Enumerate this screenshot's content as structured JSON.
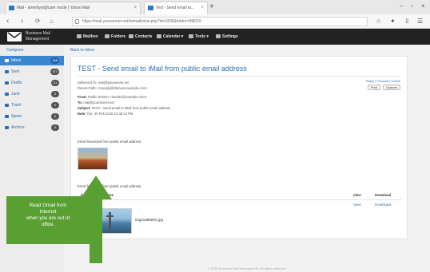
{
  "browser": {
    "tabs": [
      {
        "label": "Mail - amethyst@user mode | Yahoo Mail"
      },
      {
        "label": "Test - Send email to..."
      }
    ],
    "new_tab": "+",
    "window_controls": [
      "–",
      "▫",
      "×"
    ],
    "url": "https://mail.yourserver.net/intmail/view.php?id=1835&folder=INBOX",
    "nav_icons": [
      "back-icon",
      "forward-icon",
      "reload-icon",
      "home-icon"
    ],
    "toolbar_right": [
      "☆",
      "☰"
    ]
  },
  "app": {
    "name": "Business Mail Management",
    "menu": [
      {
        "label": "Mailbox",
        "icon": "envelope-icon"
      },
      {
        "label": "Folders",
        "icon": "folder-icon"
      },
      {
        "label": "Contacts",
        "icon": "contacts-icon"
      },
      {
        "label": "Calendar ▾",
        "icon": "calendar-icon"
      },
      {
        "label": "Tools ▾",
        "icon": "tools-icon"
      },
      {
        "label": "Settings",
        "icon": "gear-icon"
      }
    ]
  },
  "sidebar": {
    "compose": "Compose",
    "folders": [
      {
        "label": "Inbox",
        "count": "158",
        "active": true
      },
      {
        "label": "Sent",
        "count": "477",
        "active": false
      },
      {
        "label": "Drafts",
        "count": "21",
        "active": false
      },
      {
        "label": "Junk",
        "count": "0",
        "active": false
      },
      {
        "label": "Trash",
        "count": "0",
        "active": false
      },
      {
        "label": "Spam",
        "count": "0",
        "active": false
      },
      {
        "label": "Archive",
        "count": "0",
        "active": false
      }
    ]
  },
  "main": {
    "breadcrumb": "Back to Inbox",
    "subject": "TEST - Send email to iMail from public email address",
    "meta_lines": [
      "Delivered-To: mail@yourserver.net",
      "Return-Path: <noreply@domain.example.com>"
    ],
    "fields": [
      {
        "label": "From:",
        "value": "Public Sender <sender@example.com>"
      },
      {
        "label": "To:",
        "value": "mail@yourserver.net"
      },
      {
        "label": "Subject:",
        "value": "TEST - Send email to iMail from public email address"
      },
      {
        "label": "Date:",
        "value": "Tue, 20 Feb 2018 10:45:12 PM"
      }
    ],
    "actions": {
      "links": "Reply | Forward | Delete",
      "buttons": [
        "Print",
        "Options"
      ]
    },
    "body_line_1": "Email forwarded from public email address.",
    "body_line_2": "Email forwarded from public email address.",
    "attachments": {
      "headers": {
        "name": "Download File Name",
        "view": "View",
        "download": "Download"
      },
      "rows": [
        {
          "file": "img0138580X.jpg",
          "view": "View",
          "download": "Download"
        }
      ]
    },
    "footer": "© 2018 Business Mail Management. All rights reserved."
  },
  "callout": {
    "lines": [
      "Read Gmail from",
      "Internet",
      "when you are out of",
      "office."
    ],
    "color": "#5a9f32"
  }
}
